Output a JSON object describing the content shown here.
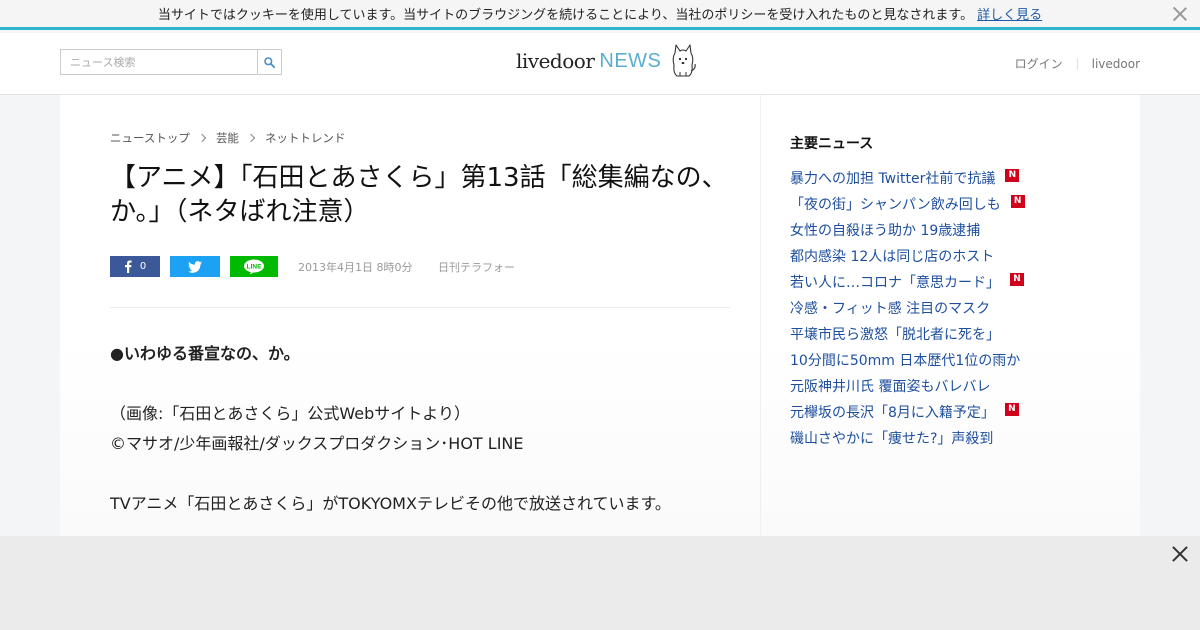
{
  "cookie_bar": {
    "message": "当サイトではクッキーを使用しています。当サイトのブラウジングを続けることにより、当社のポリシーを受け入れたものと見なされます。",
    "link": "詳しく見る",
    "close_icon": "close-icon"
  },
  "header": {
    "search_placeholder": "ニュース検索",
    "search_icon": "search-icon",
    "logo_left": "livedoor",
    "logo_right": "NEWS",
    "logo_mascot": "dog-mascot-icon",
    "nav": [
      "ログイン",
      "livedoor"
    ]
  },
  "article": {
    "breadcrumb": [
      "ニューストップ",
      "芸能",
      "ネットトレンド"
    ],
    "title": "【アニメ】「石田とあさくら」第13話「総集編なの、か。」（ネタばれ注意）",
    "share": {
      "facebook_count": "0",
      "facebook_icon": "facebook-icon",
      "twitter_icon": "twitter-icon",
      "line_label": "LINE"
    },
    "date": "2013年4月1日 8時0分",
    "source": "日刊テラフォー",
    "body": {
      "lead": "●いわゆる番宣なの、か。",
      "caption1": "（画像:「石田とあさくら」公式Webサイトより）",
      "caption2": "©マサオ/少年画報社/ダックスプロダクション･HOT LINE",
      "paragraph": "TVアニメ「石田とあさくら」がTOKYOMXテレビその他で放送されています。"
    }
  },
  "sidebar": {
    "title": "主要ニュース",
    "new_badge": "N",
    "items": [
      {
        "text": "暴力への加担 Twitter社前で抗議",
        "is_new": true
      },
      {
        "text": "「夜の街」シャンパン飲み回しも",
        "is_new": true
      },
      {
        "text": "女性の自殺ほう助か 19歳逮捕",
        "is_new": false
      },
      {
        "text": "都内感染 12人は同じ店のホスト",
        "is_new": false
      },
      {
        "text": "若い人に…コロナ「意思カード」",
        "is_new": true
      },
      {
        "text": "冷感・フィット感 注目のマスク",
        "is_new": false
      },
      {
        "text": "平壌市民ら激怒「脱北者に死を」",
        "is_new": false
      },
      {
        "text": "10分間に50mm 日本歴代1位の雨か",
        "is_new": false
      },
      {
        "text": "元阪神井川氏 覆面姿もバレバレ",
        "is_new": false
      },
      {
        "text": "元欅坂の長沢「8月に入籍予定」",
        "is_new": true
      },
      {
        "text": "磯山さやかに「痩せた?」声殺到",
        "is_new": false
      }
    ]
  },
  "ad_bar": {
    "close_icon": "close-icon"
  },
  "colors": {
    "accent": "#2fb5cc",
    "link": "#1e4f9e",
    "facebook": "#3b5998",
    "twitter": "#1da1f2",
    "line": "#00b900",
    "new_badge": "#d0021b"
  }
}
